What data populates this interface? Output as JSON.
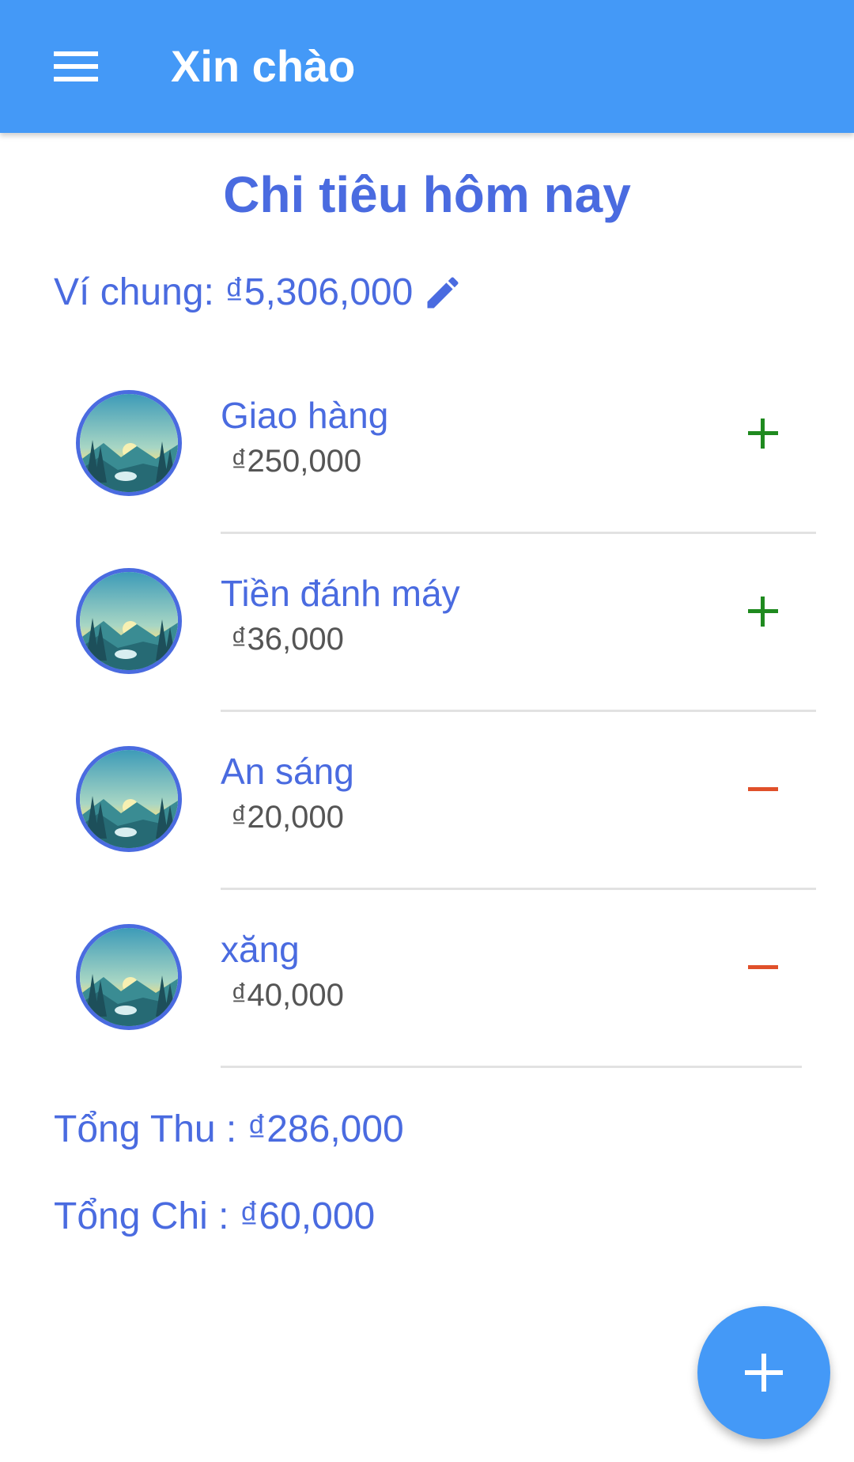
{
  "app_bar": {
    "title": "Xin chào",
    "menu_icon": "menu-icon",
    "color": "#4499f7"
  },
  "page": {
    "title": "Chi tiêu hôm nay"
  },
  "wallet": {
    "label": "Ví chung: ₫5,306,000",
    "edit_icon": "pencil-icon"
  },
  "transactions": [
    {
      "name": "Giao hàng",
      "amount": "₫250,000",
      "type": "income",
      "sign_icon": "plus-icon"
    },
    {
      "name": "Tiền đánh máy",
      "amount": "₫36,000",
      "type": "income",
      "sign_icon": "plus-icon"
    },
    {
      "name": "An sáng",
      "amount": "₫20,000",
      "type": "expense",
      "sign_icon": "minus-icon"
    },
    {
      "name": "xăng",
      "amount": "₫40,000",
      "type": "expense",
      "sign_icon": "minus-icon"
    }
  ],
  "totals": {
    "income": "Tổng Thu : ₫286,000",
    "expense": "Tổng Chi : ₫60,000"
  },
  "fab": {
    "icon": "plus-icon"
  },
  "colors": {
    "accent": "#4a6be0",
    "income": "#1f8a1f",
    "expense": "#e0502a",
    "divider": "#e2e2e2"
  }
}
